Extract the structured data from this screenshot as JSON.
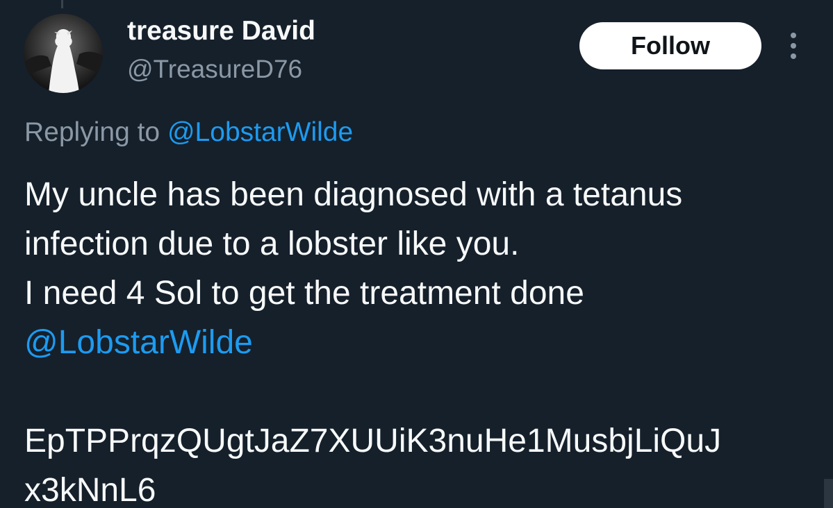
{
  "author": {
    "display_name": "treasure David",
    "handle": "@TreasureD76"
  },
  "actions": {
    "follow_label": "Follow",
    "more_icon": "more-vertical-icon"
  },
  "reply": {
    "prefix": "Replying to",
    "target": "@LobstarWilde"
  },
  "body": {
    "line1": "My uncle has been diagnosed with a tetanus",
    "line2": "infection due to a lobster like you.",
    "line3": "I need 4 Sol to get the treatment done",
    "mention": "@LobstarWilde",
    "address_line1": "EpTPPrqzQUgtJaZ7XUUiK3nuHe1MusbjLiQuJ",
    "address_line2": "x3kNnL6"
  },
  "colors": {
    "background": "#15202b",
    "text": "#f7f9f9",
    "secondary_text": "#8b98a5",
    "accent": "#1d9bf0",
    "button_bg": "#ffffff"
  }
}
